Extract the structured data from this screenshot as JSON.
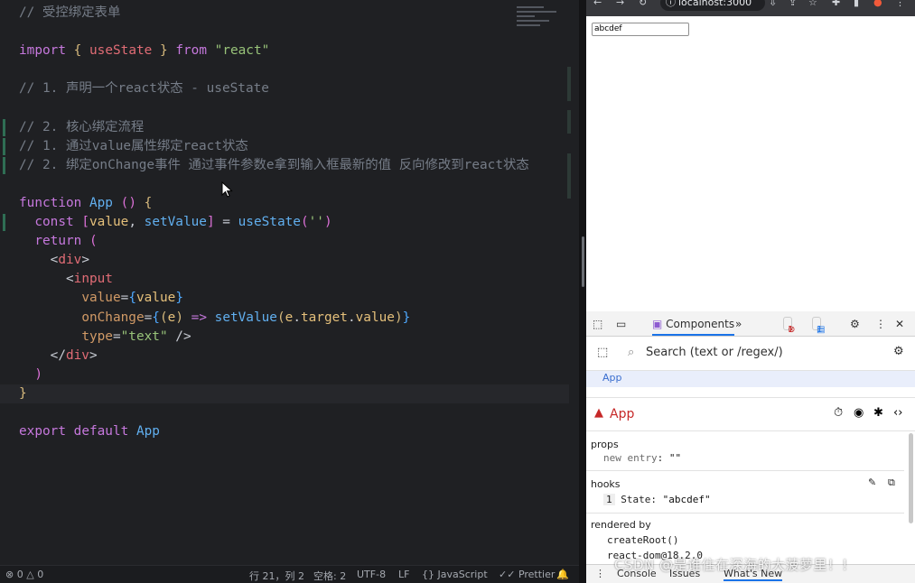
{
  "editor": {
    "lines": [
      {
        "segs": [
          [
            "c-com",
            "// 受控绑定表单"
          ]
        ]
      },
      {
        "segs": []
      },
      {
        "segs": [
          [
            "c-kw",
            "import"
          ],
          [
            "c-pl",
            " "
          ],
          [
            "c-br",
            "{"
          ],
          [
            "c-pl",
            " "
          ],
          [
            "c-tag",
            "useState"
          ],
          [
            "c-pl",
            " "
          ],
          [
            "c-br",
            "}"
          ],
          [
            "c-pl",
            " "
          ],
          [
            "c-kw",
            "from"
          ],
          [
            "c-pl",
            " "
          ],
          [
            "c-str",
            "\"react\""
          ]
        ]
      },
      {
        "segs": []
      },
      {
        "segs": [
          [
            "c-com",
            "// 1. 声明一个react状态 - useState"
          ]
        ]
      },
      {
        "segs": []
      },
      {
        "segs": [
          [
            "c-com",
            "// 2. 核心绑定流程"
          ]
        ],
        "gm": true
      },
      {
        "segs": [
          [
            "c-com",
            "// 1. 通过value属性绑定react状态"
          ]
        ],
        "gm": true
      },
      {
        "segs": [
          [
            "c-com",
            "// 2. 绑定onChange事件 通过事件参数e拿到输入框最新的值 反向修改到react状态"
          ]
        ],
        "gm": true
      },
      {
        "segs": []
      },
      {
        "segs": [
          [
            "c-kw",
            "function"
          ],
          [
            "c-pl",
            " "
          ],
          [
            "c-fn",
            "App"
          ],
          [
            "c-pl",
            " "
          ],
          [
            "c-br2",
            "()"
          ],
          [
            "c-pl",
            " "
          ],
          [
            "c-br",
            "{"
          ]
        ]
      },
      {
        "segs": [
          [
            "c-pl",
            "  "
          ],
          [
            "c-kw",
            "const"
          ],
          [
            "c-pl",
            " "
          ],
          [
            "c-br2",
            "["
          ],
          [
            "c-var",
            "value"
          ],
          [
            "c-pl",
            ", "
          ],
          [
            "c-fn",
            "setValue"
          ],
          [
            "c-br2",
            "]"
          ],
          [
            "c-pl",
            " = "
          ],
          [
            "c-fn",
            "useState"
          ],
          [
            "c-br2",
            "("
          ],
          [
            "c-str",
            "''"
          ],
          [
            "c-br2",
            ")"
          ]
        ],
        "gm": true
      },
      {
        "segs": [
          [
            "c-pl",
            "  "
          ],
          [
            "c-kw",
            "return"
          ],
          [
            "c-pl",
            " "
          ],
          [
            "c-br2",
            "("
          ]
        ]
      },
      {
        "segs": [
          [
            "c-pl",
            "    "
          ],
          [
            "c-pl",
            "<"
          ],
          [
            "c-tag",
            "div"
          ],
          [
            "c-pl",
            ">"
          ]
        ]
      },
      {
        "segs": [
          [
            "c-pl",
            "      "
          ],
          [
            "c-pl",
            "<"
          ],
          [
            "c-tag",
            "input"
          ]
        ]
      },
      {
        "segs": [
          [
            "c-pl",
            "        "
          ],
          [
            "c-attr",
            "value"
          ],
          [
            "c-pl",
            "="
          ],
          [
            "c-br3",
            "{"
          ],
          [
            "c-var",
            "value"
          ],
          [
            "c-br3",
            "}"
          ]
        ]
      },
      {
        "segs": [
          [
            "c-pl",
            "        "
          ],
          [
            "c-attr",
            "onChange"
          ],
          [
            "c-pl",
            "="
          ],
          [
            "c-br3",
            "{"
          ],
          [
            "c-br",
            "("
          ],
          [
            "c-var",
            "e"
          ],
          [
            "c-br",
            ")"
          ],
          [
            "c-pl",
            " "
          ],
          [
            "c-kw",
            "=>"
          ],
          [
            "c-pl",
            " "
          ],
          [
            "c-fn",
            "setValue"
          ],
          [
            "c-br",
            "("
          ],
          [
            "c-var",
            "e"
          ],
          [
            "c-pl",
            "."
          ],
          [
            "c-var",
            "target"
          ],
          [
            "c-pl",
            "."
          ],
          [
            "c-var",
            "value"
          ],
          [
            "c-br",
            ")"
          ],
          [
            "c-br3",
            "}"
          ]
        ]
      },
      {
        "segs": [
          [
            "c-pl",
            "        "
          ],
          [
            "c-attr",
            "type"
          ],
          [
            "c-pl",
            "="
          ],
          [
            "c-str",
            "\"text\""
          ],
          [
            "c-pl",
            " />"
          ]
        ]
      },
      {
        "segs": [
          [
            "c-pl",
            "    "
          ],
          [
            "c-pl",
            "</"
          ],
          [
            "c-tag",
            "div"
          ],
          [
            "c-pl",
            ">"
          ]
        ]
      },
      {
        "segs": [
          [
            "c-pl",
            "  "
          ],
          [
            "c-br2",
            ")"
          ]
        ]
      },
      {
        "segs": [
          [
            "c-br",
            "}"
          ]
        ],
        "hl": true
      },
      {
        "segs": []
      },
      {
        "segs": [
          [
            "c-kw",
            "export"
          ],
          [
            "c-pl",
            " "
          ],
          [
            "c-kw",
            "default"
          ],
          [
            "c-pl",
            " "
          ],
          [
            "c-fn",
            "App"
          ]
        ]
      }
    ]
  },
  "statusbar": {
    "errors": "0",
    "warnings": "0",
    "position": "行 21，列 2",
    "spaces": "空格: 2",
    "encoding": "UTF-8",
    "eol": "LF",
    "language": "JavaScript",
    "formatter": "Prettier"
  },
  "browser": {
    "url": "localhost:3000",
    "input_value": "abcdef"
  },
  "devtools": {
    "components_tab": "Components",
    "error_count": "1",
    "message_count": "1",
    "search_placeholder": "Search (text or /regex/)",
    "tree_item": "App",
    "selected_component": "App",
    "props_label": "props",
    "props_key": "new entry",
    "props_value": "\"\"",
    "hooks_label": "hooks",
    "hook_index": "1",
    "hook_name": "State",
    "hook_value": "\"abcdef\"",
    "rendered_by_label": "rendered by",
    "rendered_by": [
      "createRoot()",
      "react-dom@18.2.0"
    ],
    "bottom_tabs": [
      "Console",
      "Issues",
      "What's New"
    ]
  },
  "watermark": "CSDN @是谁住在深海的大菠萝里！！"
}
